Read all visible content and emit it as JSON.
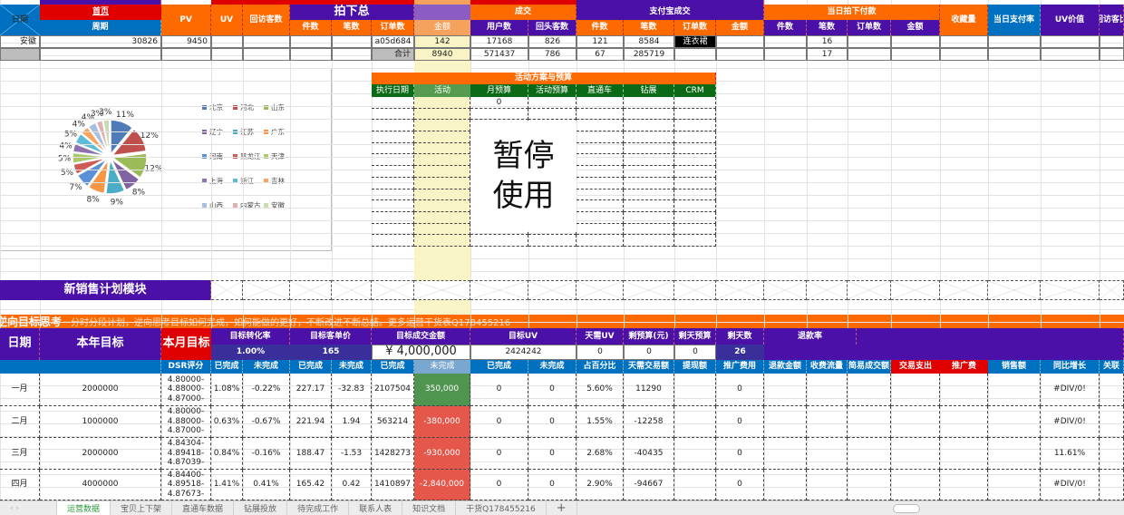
{
  "top_header": {
    "date": "日期",
    "home": "首页",
    "period": "周期",
    "pv": "PV",
    "uv": "UV",
    "revisit": "回访客数",
    "ordered_total": "拍下总",
    "ordered_sub": [
      "件数",
      "笔数",
      "订单数",
      "金额"
    ],
    "deal": "成交",
    "deal_sub": [
      "用户数",
      "回头客数"
    ],
    "alipay": "支付宝成交",
    "alipay_sub": [
      "件数",
      "笔数",
      "订单数",
      "金额"
    ],
    "today_paid": "当日拍下付款",
    "today_sub": [
      "件数",
      "笔数",
      "订单数",
      "金额"
    ],
    "favorites": "收藏量",
    "pay_rate": "当日支付率",
    "uv_value": "UV价值",
    "revisit_ratio": "回访客比"
  },
  "top_rows": [
    [
      "安徽",
      "30826",
      "9450",
      "",
      "",
      "",
      "",
      "a05d684",
      "142",
      "17168",
      "826",
      "121",
      "8584",
      "连衣裙",
      "",
      "",
      "16",
      "",
      "",
      "",
      "",
      "",
      ""
    ],
    [
      "",
      "",
      "",
      "",
      "",
      "",
      "",
      "合计",
      "8940",
      "571437",
      "786",
      "67",
      "285719",
      "",
      "",
      "",
      "17",
      "",
      "",
      "",
      "",
      "",
      ""
    ]
  ],
  "chart_data": {
    "type": "pie",
    "title": "",
    "categories": [
      "北京",
      "河北",
      "山东",
      "辽宁",
      "江苏",
      "广东",
      "河南",
      "黑龙江",
      "天津",
      "上海",
      "浙江",
      "吉林",
      "山西",
      "内蒙古",
      "安徽"
    ],
    "values": [
      11,
      12,
      12,
      8,
      9,
      8,
      7,
      5,
      5,
      4,
      5,
      4,
      4,
      3,
      3
    ],
    "labels": [
      "11%",
      "12%",
      "12%",
      "8%",
      "9%",
      "8%",
      "7%",
      "5%",
      "5%",
      "4%",
      "5%",
      "4%",
      "4%",
      "3%",
      "3%"
    ],
    "colors": [
      "#4f7cb8",
      "#c0504d",
      "#9bbb59",
      "#8064a2",
      "#4bacc6",
      "#f79646",
      "#5b8fd6",
      "#d05a55",
      "#a9c96a",
      "#8e72b0",
      "#5cbcd6",
      "#f9a45c",
      "#a8c0e0",
      "#e0b0b0",
      "#c8dcb0"
    ],
    "legend_position": "right"
  },
  "activity": {
    "title": "活动方案与预算",
    "headers": [
      "执行日期",
      "活动",
      "月预算",
      "活动预算",
      "直通车",
      "钻展",
      "CRM"
    ],
    "first_row_budget": "0",
    "paused_line1": "暂停",
    "paused_line2": "使用"
  },
  "module_title": "新销售计划模块",
  "banner": {
    "title": "逆向目标思考",
    "text": "－分时分段计划，逆向思考目标如何完成，如何能做的更好，不断改进不断总结。更多运营干货表Q178455216"
  },
  "plan_header": {
    "date": "日期",
    "year_target": "本年目标",
    "month_target": "本月目标",
    "conv_rate": "目标转化率",
    "conv_rate_value": "1.00%",
    "unit_price": "目标客单价",
    "unit_price_value": "165",
    "amount": "目标成交金额",
    "amount_value": "¥   4,000,000",
    "target_uv": "目标UV",
    "target_uv_value": "2424242",
    "daily_uv": "天需UV",
    "daily_uv_value": "0",
    "remain_budget": "剩预算(元)",
    "remain_budget_value": "0",
    "remain_daily_budget": "剩天预算",
    "remain_daily_budget_value": "0",
    "remain_days": "剩天数",
    "remain_days_value": "26",
    "refund_rate": "退款率"
  },
  "plan_sub": [
    "DSR评分",
    "已完成",
    "未完成",
    "已完成",
    "未完成",
    "已完成",
    "未完成",
    "已完成",
    "未完成",
    "占百分比",
    "天需交易额",
    "提现额",
    "推广费用",
    "退款金额",
    "收费流量",
    "简易成交额",
    "交易支出",
    "推广费",
    "销售额",
    "同比增长",
    "关联"
  ],
  "plan_rows": [
    {
      "month": "一月",
      "year": "2000000",
      "dsr": [
        "4.80000-",
        "4.88000-",
        "4.87000-"
      ],
      "cells": [
        "1.08%",
        "-0.22%",
        "227.17",
        "-32.83",
        "2107504",
        "350,000",
        "0",
        "0",
        "5.60%",
        "11290",
        "",
        "0",
        "",
        "",
        "",
        "",
        "",
        "",
        "#DIV/0!",
        ""
      ],
      "status": "good"
    },
    {
      "month": "二月",
      "year": "1000000",
      "dsr": [
        "4.80000-",
        "4.88000-",
        "4.87000-"
      ],
      "cells": [
        "0.63%",
        "-0.67%",
        "221.94",
        "1.94",
        "563214",
        "-380,000",
        "0",
        "0",
        "1.55%",
        "-12258",
        "",
        "0",
        "",
        "",
        "",
        "",
        "",
        "",
        "#DIV/0!",
        ""
      ],
      "status": "bad"
    },
    {
      "month": "三月",
      "year": "2000000",
      "dsr": [
        "4.84304-",
        "4.89418-",
        "4.87039-"
      ],
      "cells": [
        "0.84%",
        "-0.16%",
        "188.47",
        "-1.53",
        "1428273",
        "-930,000",
        "0",
        "0",
        "2.68%",
        "-40435",
        "",
        "0",
        "",
        "",
        "",
        "",
        "",
        "",
        "11.61%",
        ""
      ],
      "status": "bad"
    },
    {
      "month": "四月",
      "year": "4000000",
      "dsr": [
        "4.84400-",
        "4.89518-",
        "4.87673-"
      ],
      "cells": [
        "1.41%",
        "0.41%",
        "165.42",
        "0.42",
        "1410897",
        "-2,840,000",
        "0",
        "0",
        "2.90%",
        "-94667",
        "",
        "0",
        "",
        "",
        "",
        "",
        "",
        "",
        "#DIV/0!",
        ""
      ],
      "status": "bad"
    }
  ],
  "tabs": [
    "运营数据",
    "宝贝上下架",
    "直通车数据",
    "钻展投放",
    "待完成工作",
    "联系人表",
    "知识文档",
    "干货Q178455216"
  ],
  "add_tab": "+"
}
